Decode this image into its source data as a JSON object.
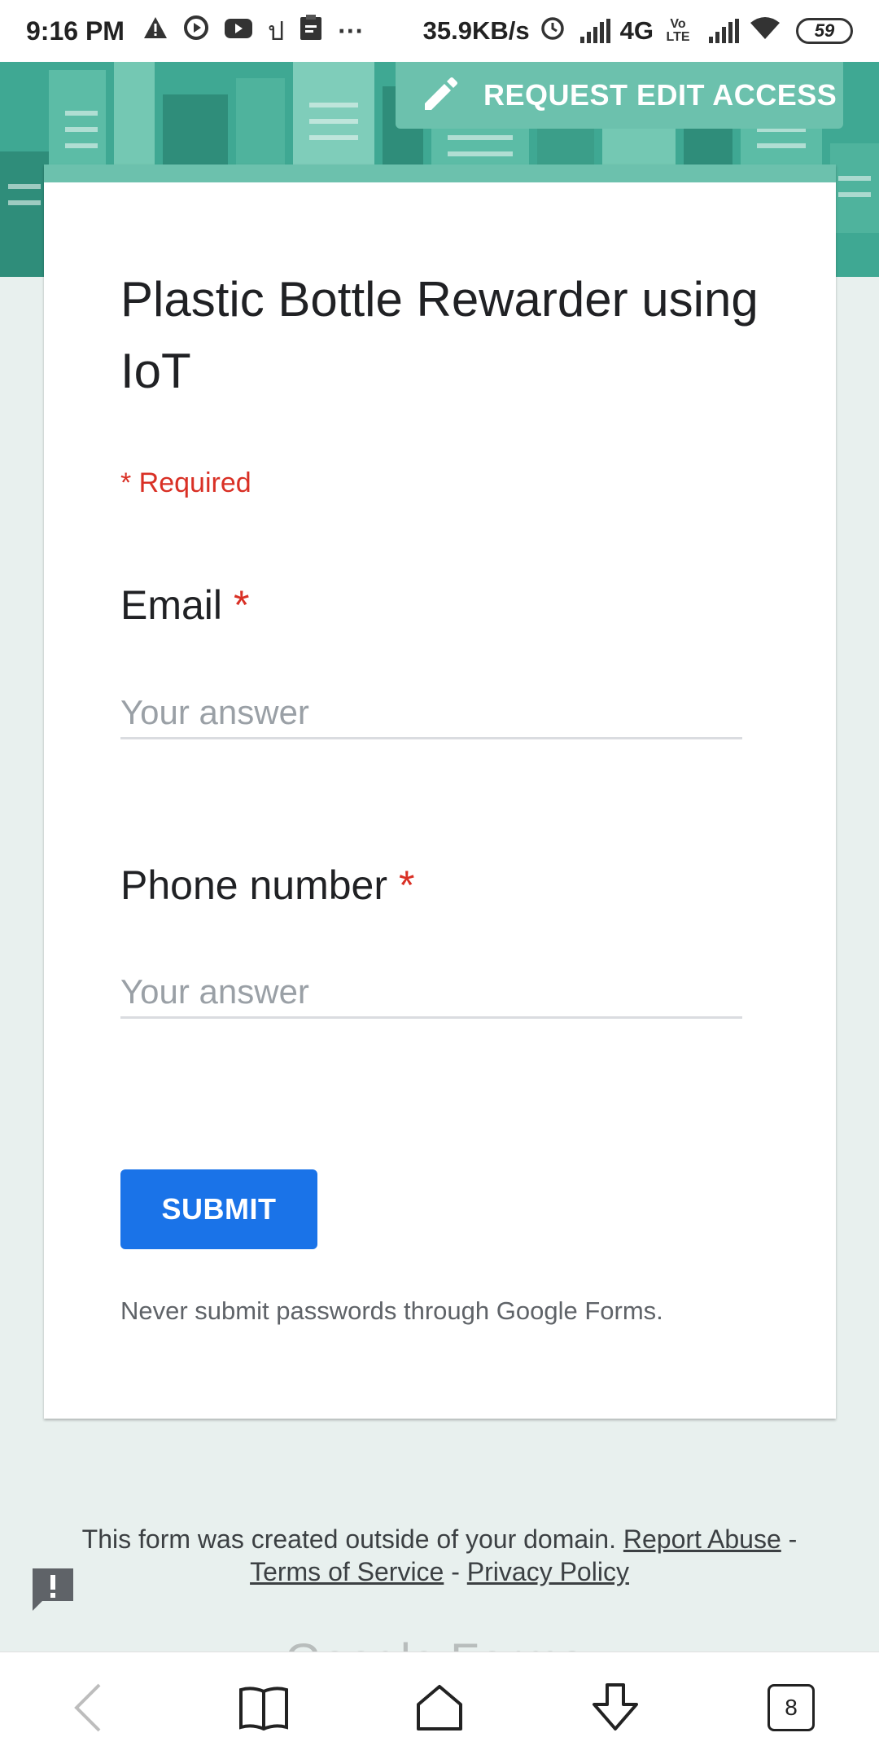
{
  "status_bar": {
    "time": "9:16 PM",
    "speed": "35.9KB/s",
    "network": "4G",
    "volte": "Vo LTE",
    "battery": "59",
    "icons": [
      "warning-icon",
      "play-icon",
      "youtube-icon",
      "sim-icon",
      "clipboard-icon",
      "more-icon",
      "alarm-icon",
      "signal-icon",
      "wifi-icon",
      "battery-icon"
    ]
  },
  "header": {
    "edit_access_label": "REQUEST EDIT ACCESS"
  },
  "form": {
    "title": "Plastic Bottle Rewarder using IoT",
    "required_note": "* Required",
    "questions": [
      {
        "label": "Email",
        "required_mark": "*",
        "placeholder": "Your answer"
      },
      {
        "label": "Phone number",
        "required_mark": "*",
        "placeholder": "Your answer"
      }
    ],
    "submit_label": "SUBMIT",
    "password_note": "Never submit passwords through Google Forms."
  },
  "footer": {
    "created_outside": "This form was created outside of your domain.",
    "report_abuse": "Report Abuse",
    "terms": "Terms of Service",
    "privacy": "Privacy Policy",
    "separator": "-",
    "brand": "Google Forms"
  },
  "bottom_nav": {
    "tabs_count": "8"
  },
  "colors": {
    "accent": "#6cc1ad",
    "banner": "#3fa893",
    "submit": "#1a73e8",
    "required": "#d93025",
    "background": "#e8f0ee"
  }
}
